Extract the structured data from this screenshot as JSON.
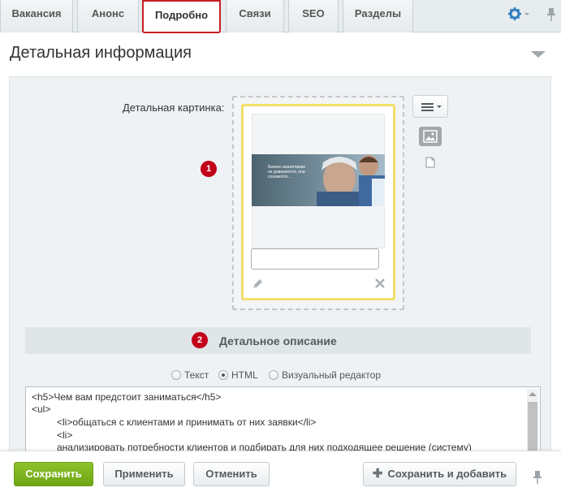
{
  "tabs": [
    {
      "label": "Вакансия"
    },
    {
      "label": "Анонс"
    },
    {
      "label": "Подробно",
      "active": true
    },
    {
      "label": "Связи"
    },
    {
      "label": "SEO"
    },
    {
      "label": "Разделы"
    }
  ],
  "section": {
    "title": "Детальная информация"
  },
  "detail_picture": {
    "label": "Детальная картинка:",
    "image_caption": "Бизнес-аналитикам не доверяются, они сознаются...",
    "description_value": ""
  },
  "badges": {
    "first": "1",
    "second": "2"
  },
  "detail_description": {
    "title": "Детальное описание",
    "mode_options": [
      {
        "label": "Текст",
        "checked": false
      },
      {
        "label": "HTML",
        "checked": true
      },
      {
        "label": "Визуальный редактор",
        "checked": false
      }
    ],
    "code_lines": [
      "<h5>Чем вам предстоит заниматься</h5>",
      "<ul>",
      "    <li>общаться с клиентами и принимать от них заявки</li>",
      "    <li>",
      "    анализировать потребности клиентов и подбирать для них подходящее решение (систему)"
    ]
  },
  "footer": {
    "save": "Сохранить",
    "apply": "Применить",
    "cancel": "Отменить",
    "save_add": "Сохранить и добавить"
  },
  "colors": {
    "active_tab_border": "#c81e24",
    "save_button": "#7ab51d",
    "badge": "#c3001a",
    "card_border": "#f2df6a"
  },
  "icons": {
    "settings": "gear-icon",
    "pin": "pin-icon",
    "menu": "hamburger-icon",
    "image": "image-icon",
    "file": "file-icon",
    "edit": "pencil-icon",
    "delete": "close-icon"
  }
}
